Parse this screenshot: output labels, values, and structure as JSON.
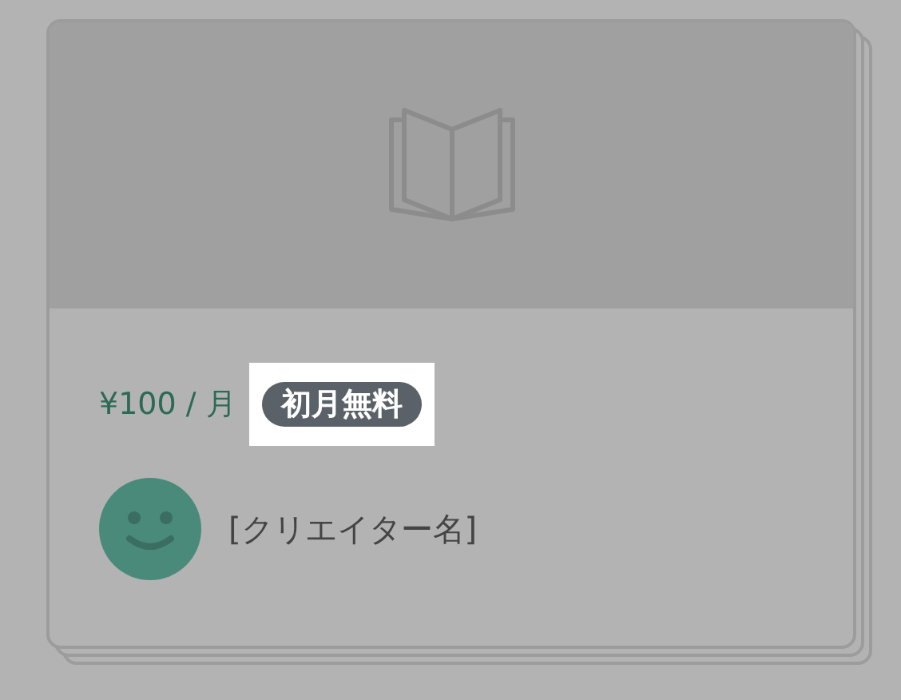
{
  "card": {
    "kind": "picture",
    "price": "¥100 / 月",
    "badge": "初月無料",
    "badge_highlighted": true,
    "creator": "[クリエイター名]"
  }
}
